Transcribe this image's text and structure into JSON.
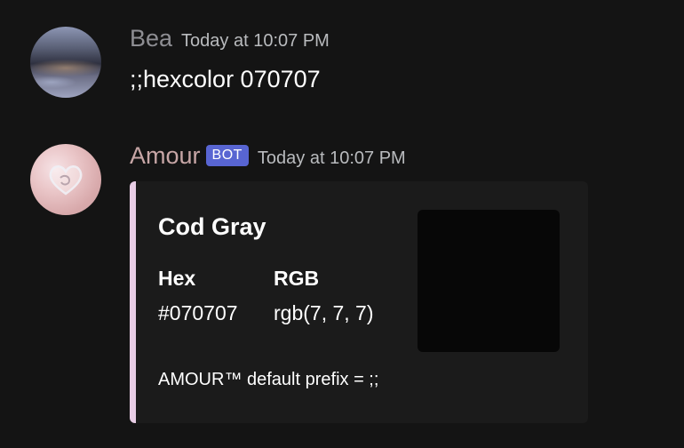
{
  "messages": [
    {
      "username": "Bea",
      "timestamp": "Today at 10:07 PM",
      "content": ";;hexcolor 070707",
      "name_color": "#8e8e93"
    },
    {
      "username": "Amour",
      "badge": "BOT",
      "timestamp": "Today at 10:07 PM",
      "name_color": "#c7a6a6",
      "embed": {
        "accent_color": "#e8cde5",
        "title": "Cod Gray",
        "fields": [
          {
            "name": "Hex",
            "value": "#070707"
          },
          {
            "name": "RGB",
            "value": "rgb(7, 7, 7)"
          }
        ],
        "thumbnail_color": "#070707",
        "footer": "AMOUR™ default prefix = ;;"
      }
    }
  ],
  "colors": {
    "background": "#141414",
    "embed_background": "#1b1b1b",
    "bot_badge": "#5865d2"
  }
}
